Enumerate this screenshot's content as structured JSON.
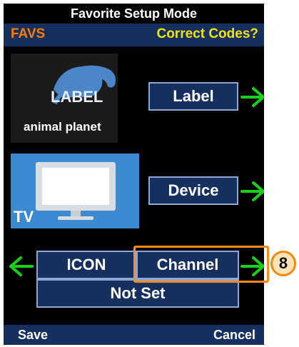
{
  "header": {
    "title": "Favorite Setup Mode",
    "left_label": "FAVS",
    "right_label": "Correct Codes?"
  },
  "favorite": {
    "logo_overlay_text": "LABEL",
    "logo_brand_text": "animal planet",
    "device_tile_text": "TV",
    "label_button": "Label",
    "device_button": "Device",
    "icon_button": "ICON",
    "channel_button": "Channel",
    "channel_value": "Not Set"
  },
  "footer": {
    "save_label": "Save",
    "cancel_label": "Cancel"
  },
  "callout": {
    "number": "8"
  },
  "colors": {
    "screen_bg": "#000000",
    "bar_blue": "#15305e",
    "button_border": "#8ea6d6",
    "favs_orange": "#ff7a00",
    "codes_yellow": "#f4e400",
    "arrow_green": "#19d019",
    "callout_orange": "#ff8c1a"
  },
  "icons": [
    "elephant-logo-icon",
    "tv-monitor-icon",
    "arrow-right-icon",
    "arrow-left-icon"
  ]
}
